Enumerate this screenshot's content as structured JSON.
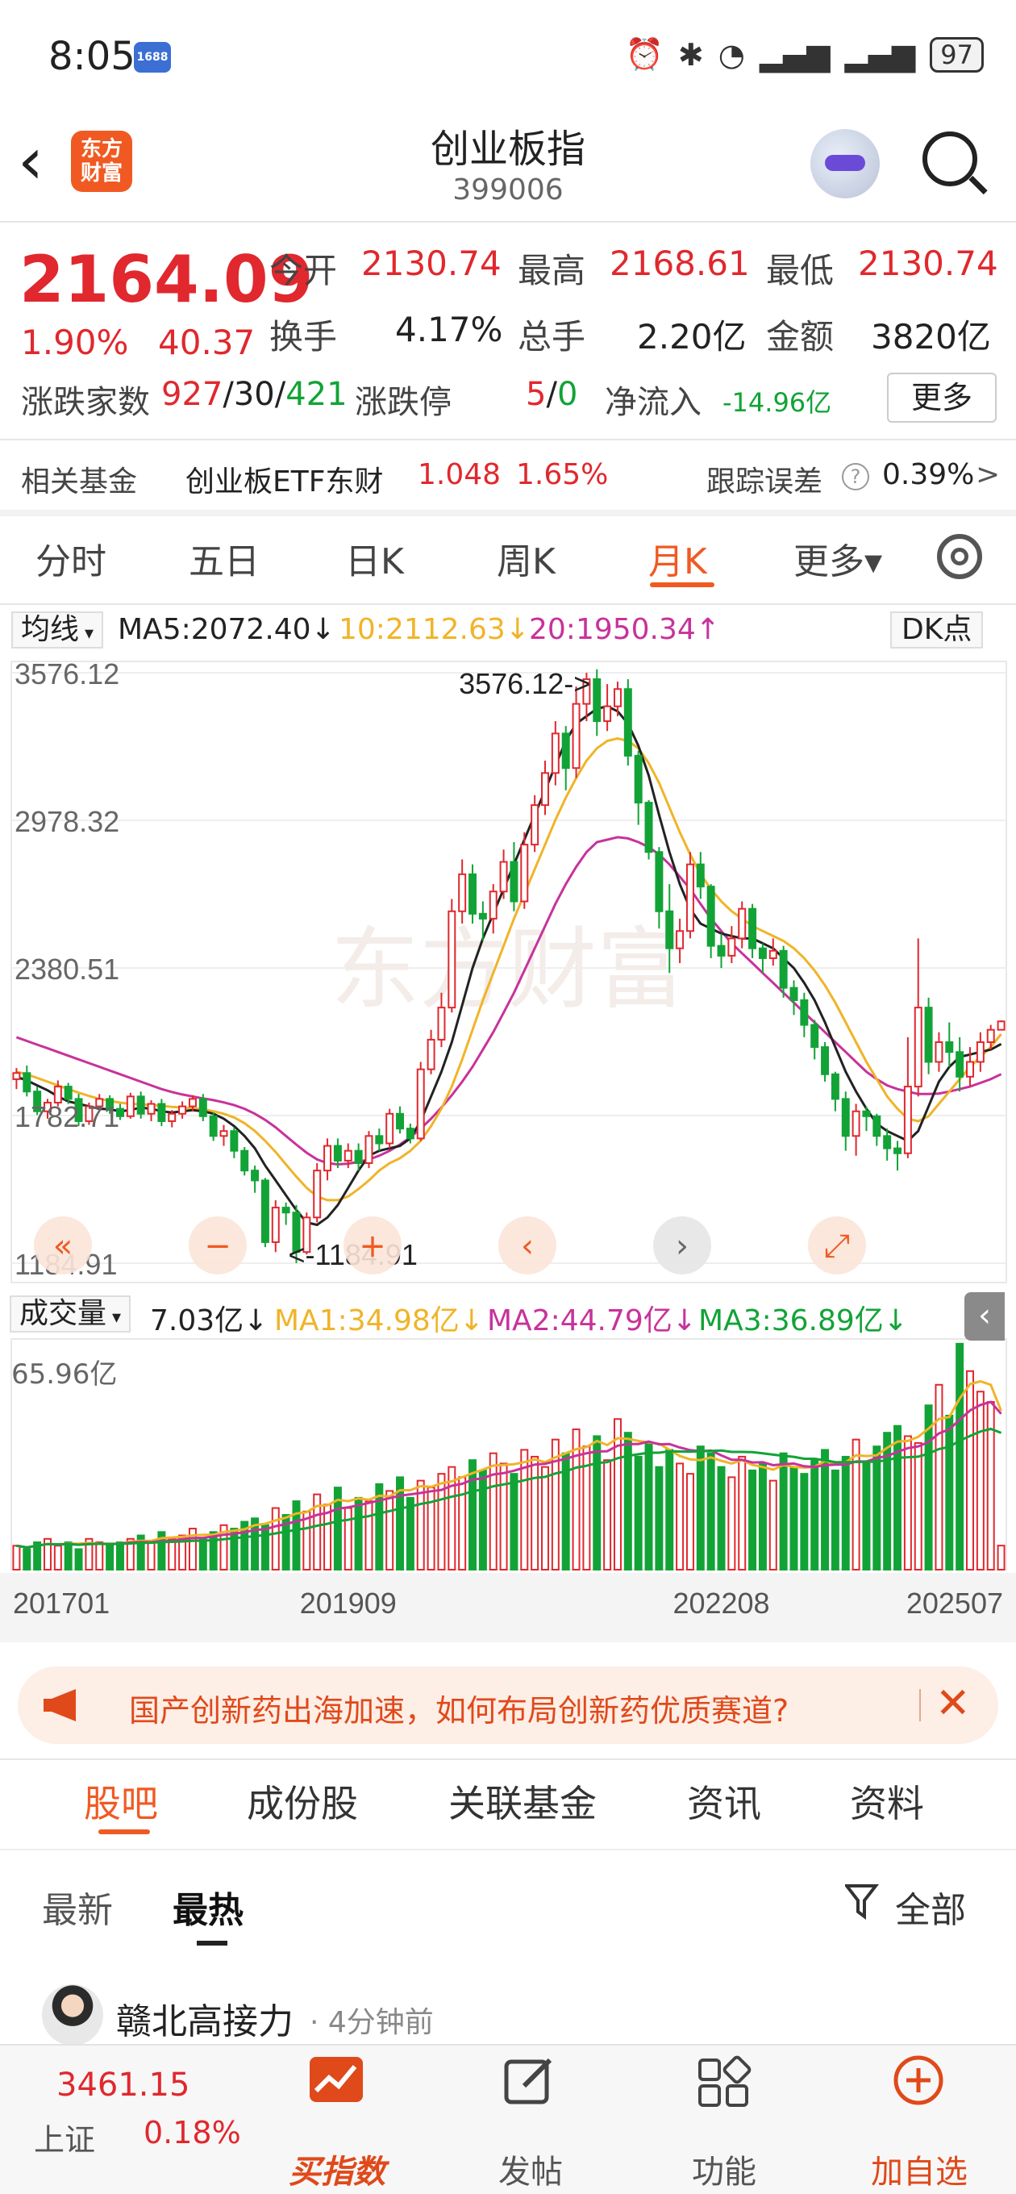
{
  "status_bar": {
    "time": "8:05",
    "app_badge": "1688",
    "battery": "97"
  },
  "header": {
    "logo": "东方财富",
    "title": "创业板指",
    "code": "399006"
  },
  "quote": {
    "price": "2164.09",
    "change_pct": "1.90%",
    "change_abs": "40.37",
    "open_label": "今开",
    "open": "2130.74",
    "high_label": "最高",
    "high": "2168.61",
    "low_label": "最低",
    "low": "2130.74",
    "turnover_label": "换手",
    "turnover": "4.17%",
    "volume_label": "总手",
    "volume": "2.20亿",
    "amount_label": "金额",
    "amount": "3820亿",
    "breadth_label": "涨跌家数",
    "breadth_up": "927",
    "breadth_flat": "30",
    "breadth_down": "421",
    "limit_label": "涨跌停",
    "limit_up": "5",
    "limit_down": "0",
    "inflow_label": "净流入",
    "inflow": "-14.96亿",
    "more_label": "更多"
  },
  "related_fund": {
    "label": "相关基金",
    "name": "创业板ETF东财",
    "price": "1.048",
    "pct": "1.65%",
    "tracking_label": "跟踪误差",
    "tracking_value": "0.39%",
    "arrow": ">"
  },
  "period_tabs": {
    "items": [
      "分时",
      "五日",
      "日K",
      "周K",
      "月K",
      "更多▾"
    ],
    "active": "月K"
  },
  "ma_legend": {
    "selector": "均线",
    "ma5": "MA5:2072.40↓",
    "ma10": "10:2112.63↓",
    "ma20": "20:1950.34↑",
    "dk": "DK点"
  },
  "colors": {
    "ma5": "#222222",
    "ma10": "#f0b428",
    "ma20": "#c8329b",
    "up": "#e0282e",
    "down": "#12a337",
    "accent": "#f05a22"
  },
  "chart_data": {
    "type": "candlestick",
    "period": "月K",
    "y_ticks": [
      "3576.12",
      "2978.32",
      "2380.51",
      "1782.71",
      "1184.91"
    ],
    "ylim": [
      1184.91,
      3576.12
    ],
    "annotations": [
      "3576.12->",
      "<-1184.91"
    ],
    "x_ticks": [
      "201701",
      "201909",
      "202208",
      "202507"
    ],
    "watermark": "东方财富",
    "candles": [
      [
        1930,
        1955,
        1890,
        1975
      ],
      [
        1955,
        1880,
        1860,
        1985
      ],
      [
        1880,
        1800,
        1785,
        1900
      ],
      [
        1800,
        1835,
        1770,
        1850
      ],
      [
        1835,
        1900,
        1820,
        1925
      ],
      [
        1900,
        1850,
        1830,
        1915
      ],
      [
        1850,
        1760,
        1740,
        1870
      ],
      [
        1760,
        1820,
        1745,
        1835
      ],
      [
        1820,
        1850,
        1800,
        1870
      ],
      [
        1850,
        1810,
        1790,
        1865
      ],
      [
        1810,
        1780,
        1765,
        1830
      ],
      [
        1780,
        1860,
        1770,
        1875
      ],
      [
        1860,
        1790,
        1770,
        1880
      ],
      [
        1790,
        1830,
        1760,
        1845
      ],
      [
        1830,
        1760,
        1740,
        1850
      ],
      [
        1760,
        1790,
        1735,
        1805
      ],
      [
        1790,
        1820,
        1770,
        1840
      ],
      [
        1820,
        1850,
        1800,
        1865
      ],
      [
        1850,
        1780,
        1760,
        1870
      ],
      [
        1780,
        1700,
        1680,
        1795
      ],
      [
        1700,
        1720,
        1660,
        1745
      ],
      [
        1720,
        1640,
        1610,
        1735
      ],
      [
        1640,
        1560,
        1540,
        1655
      ],
      [
        1560,
        1520,
        1470,
        1580
      ],
      [
        1520,
        1270,
        1250,
        1530
      ],
      [
        1270,
        1410,
        1230,
        1440
      ],
      [
        1410,
        1390,
        1340,
        1430
      ],
      [
        1390,
        1230,
        1184.91,
        1420
      ],
      [
        1230,
        1370,
        1220,
        1390
      ],
      [
        1370,
        1560,
        1350,
        1590
      ],
      [
        1560,
        1660,
        1520,
        1690
      ],
      [
        1660,
        1600,
        1570,
        1690
      ],
      [
        1600,
        1640,
        1570,
        1670
      ],
      [
        1640,
        1590,
        1560,
        1670
      ],
      [
        1590,
        1700,
        1570,
        1720
      ],
      [
        1700,
        1670,
        1640,
        1730
      ],
      [
        1670,
        1790,
        1650,
        1810
      ],
      [
        1790,
        1730,
        1710,
        1820
      ],
      [
        1730,
        1690,
        1670,
        1750
      ],
      [
        1690,
        1970,
        1680,
        2000
      ],
      [
        1970,
        2090,
        1950,
        2130
      ],
      [
        2090,
        2220,
        2060,
        2280
      ],
      [
        2220,
        2610,
        2200,
        2660
      ],
      [
        2610,
        2760,
        2560,
        2820
      ],
      [
        2760,
        2600,
        2560,
        2800
      ],
      [
        2600,
        2580,
        2490,
        2650
      ],
      [
        2580,
        2690,
        2520,
        2720
      ],
      [
        2690,
        2810,
        2660,
        2860
      ],
      [
        2810,
        2650,
        2610,
        2890
      ],
      [
        2650,
        2880,
        2620,
        2930
      ],
      [
        2880,
        3040,
        2850,
        3080
      ],
      [
        3040,
        3170,
        3000,
        3220
      ],
      [
        3170,
        3330,
        3120,
        3380
      ],
      [
        3330,
        3190,
        3100,
        3360
      ],
      [
        3190,
        3450,
        3150,
        3520
      ],
      [
        3450,
        3550,
        3380,
        3576.12
      ],
      [
        3550,
        3380,
        3320,
        3590
      ],
      [
        3380,
        3440,
        3340,
        3530
      ],
      [
        3440,
        3510,
        3400,
        3540
      ],
      [
        3510,
        3240,
        3200,
        3550
      ],
      [
        3240,
        3050,
        2960,
        3260
      ],
      [
        3050,
        2850,
        2820,
        3060
      ],
      [
        2850,
        2610,
        2540,
        2870
      ],
      [
        2610,
        2460,
        2360,
        2720
      ],
      [
        2460,
        2530,
        2400,
        2580
      ],
      [
        2530,
        2800,
        2500,
        2850
      ],
      [
        2800,
        2710,
        2660,
        2850
      ],
      [
        2710,
        2470,
        2420,
        2720
      ],
      [
        2470,
        2430,
        2380,
        2520
      ],
      [
        2430,
        2500,
        2400,
        2550
      ],
      [
        2500,
        2620,
        2460,
        2650
      ],
      [
        2620,
        2460,
        2420,
        2640
      ],
      [
        2460,
        2420,
        2360,
        2480
      ],
      [
        2420,
        2450,
        2390,
        2500
      ],
      [
        2450,
        2300,
        2260,
        2470
      ],
      [
        2300,
        2250,
        2190,
        2330
      ],
      [
        2250,
        2150,
        2100,
        2280
      ],
      [
        2150,
        2060,
        2010,
        2170
      ],
      [
        2060,
        1950,
        1920,
        2080
      ],
      [
        1950,
        1850,
        1800,
        1960
      ],
      [
        1850,
        1700,
        1640,
        1880
      ],
      [
        1700,
        1800,
        1620,
        1830
      ],
      [
        1800,
        1780,
        1720,
        1820
      ],
      [
        1780,
        1700,
        1660,
        1790
      ],
      [
        1700,
        1650,
        1600,
        1730
      ],
      [
        1650,
        1630,
        1560,
        1680
      ],
      [
        1630,
        1900,
        1610,
        2100
      ],
      [
        1900,
        2220,
        1860,
        2500
      ],
      [
        2220,
        2000,
        1950,
        2260
      ],
      [
        2000,
        2080,
        1960,
        2120
      ],
      [
        2080,
        2040,
        1980,
        2160
      ],
      [
        2040,
        1940,
        1880,
        2100
      ],
      [
        1940,
        2000,
        1900,
        2060
      ],
      [
        2000,
        2080,
        1960,
        2120
      ],
      [
        2080,
        2130,
        2050,
        2150
      ],
      [
        2130,
        2164.09,
        2130.74,
        2168.61
      ]
    ],
    "ma5": [
      1940,
      1925,
      1905,
      1885,
      1860,
      1840,
      1830,
      1820,
      1810,
      1808,
      1800,
      1805,
      1815,
      1810,
      1800,
      1795,
      1800,
      1805,
      1800,
      1790,
      1770,
      1740,
      1700,
      1650,
      1580,
      1520,
      1460,
      1400,
      1350,
      1340,
      1370,
      1420,
      1490,
      1560,
      1620,
      1640,
      1650,
      1660,
      1690,
      1760,
      1860,
      1960,
      2080,
      2230,
      2380,
      2500,
      2600,
      2700,
      2800,
      2900,
      3000,
      3100,
      3200,
      3300,
      3370,
      3400,
      3430,
      3440,
      3420,
      3370,
      3280,
      3160,
      3000,
      2850,
      2720,
      2620,
      2560,
      2540,
      2520,
      2510,
      2500,
      2500,
      2480,
      2460,
      2420,
      2380,
      2320,
      2250,
      2160,
      2060,
      1960,
      1880,
      1810,
      1750,
      1720,
      1700,
      1680,
      1720,
      1820,
      1920,
      1980,
      2020,
      2030,
      2040,
      2050,
      2072.4
    ],
    "ma10": [
      1960,
      1950,
      1935,
      1920,
      1905,
      1890,
      1875,
      1862,
      1850,
      1842,
      1835,
      1830,
      1828,
      1826,
      1822,
      1818,
      1815,
      1812,
      1808,
      1800,
      1790,
      1775,
      1752,
      1720,
      1680,
      1635,
      1585,
      1535,
      1490,
      1455,
      1440,
      1440,
      1455,
      1485,
      1520,
      1560,
      1590,
      1610,
      1640,
      1680,
      1740,
      1810,
      1900,
      2010,
      2130,
      2250,
      2360,
      2470,
      2580,
      2680,
      2780,
      2880,
      2980,
      3070,
      3150,
      3220,
      3270,
      3300,
      3310,
      3300,
      3270,
      3210,
      3130,
      3030,
      2930,
      2840,
      2760,
      2700,
      2650,
      2610,
      2580,
      2550,
      2530,
      2510,
      2490,
      2460,
      2420,
      2370,
      2310,
      2240,
      2160,
      2080,
      2000,
      1930,
      1860,
      1810,
      1770,
      1760,
      1780,
      1830,
      1880,
      1930,
      1980,
      2020,
      2060,
      2112.63
    ],
    "ma20": [
      2100,
      2085,
      2070,
      2055,
      2040,
      2025,
      2010,
      1995,
      1980,
      1965,
      1950,
      1935,
      1920,
      1905,
      1890,
      1878,
      1868,
      1860,
      1852,
      1845,
      1836,
      1825,
      1810,
      1790,
      1765,
      1735,
      1700,
      1665,
      1632,
      1605,
      1590,
      1585,
      1588,
      1595,
      1605,
      1620,
      1640,
      1665,
      1695,
      1730,
      1770,
      1815,
      1865,
      1920,
      1980,
      2050,
      2120,
      2200,
      2280,
      2370,
      2460,
      2550,
      2640,
      2720,
      2790,
      2850,
      2890,
      2900,
      2910,
      2905,
      2890,
      2870,
      2840,
      2800,
      2750,
      2700,
      2640,
      2580,
      2530,
      2480,
      2440,
      2400,
      2360,
      2320,
      2280,
      2240,
      2200,
      2160,
      2120,
      2080,
      2040,
      2000,
      1960,
      1930,
      1905,
      1890,
      1880,
      1870,
      1870,
      1872,
      1880,
      1890,
      1900,
      1915,
      1930,
      1950.34
    ]
  },
  "volume_legend": {
    "selector": "成交量",
    "vol": "7.03亿↓",
    "ma1": "MA1:34.98亿↓",
    "ma2": "MA2:44.79亿↓",
    "ma3": "MA3:36.89亿↓",
    "max_label": "65.96亿"
  },
  "volume_data": {
    "unit": "亿",
    "max": 65.96,
    "values": [
      7,
      6,
      8,
      9,
      7,
      8,
      6,
      9,
      8,
      7,
      8,
      9,
      10,
      8,
      11,
      9,
      10,
      12,
      9,
      11,
      13,
      12,
      14,
      15,
      13,
      18,
      16,
      20,
      17,
      22,
      19,
      24,
      18,
      21,
      20,
      25,
      23,
      27,
      21,
      26,
      24,
      28,
      30,
      27,
      32,
      29,
      34,
      31,
      28,
      35,
      33,
      30,
      38,
      34,
      41,
      36,
      39,
      32,
      44,
      40,
      33,
      37,
      30,
      35,
      31,
      28,
      36,
      34,
      30,
      27,
      33,
      29,
      31,
      26,
      34,
      30,
      28,
      32,
      35,
      29,
      33,
      38,
      31,
      36,
      40,
      42,
      39,
      37,
      48,
      54,
      45,
      66,
      58,
      52,
      49,
      7.03
    ]
  },
  "banner": {
    "text": "国产创新药出海加速，如何布局创新药优质赛道?",
    "close": "✕"
  },
  "content_tabs": {
    "items": [
      "股吧",
      "成份股",
      "关联基金",
      "资讯",
      "资料"
    ],
    "active": "股吧"
  },
  "sort_tabs": {
    "latest": "最新",
    "hottest": "最热",
    "filter": "全部"
  },
  "post": {
    "author": "赣北高接力",
    "time": "· 4分钟前"
  },
  "bottom_bar": {
    "index_price": "3461.15",
    "index_name": "上证",
    "index_pct": "0.18%",
    "items": [
      "买指数",
      "发帖",
      "功能",
      "加自选"
    ]
  }
}
